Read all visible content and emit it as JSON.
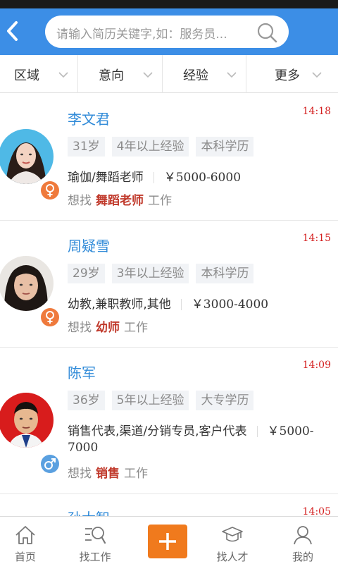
{
  "header": {
    "search_placeholder": "请输入简历关键字,如：服务员..."
  },
  "filters": [
    {
      "label": "区域"
    },
    {
      "label": "意向"
    },
    {
      "label": "经验"
    },
    {
      "label": "更多"
    }
  ],
  "candidates": [
    {
      "name": "李文君",
      "time": "14:18",
      "gender": "female",
      "age": "31岁",
      "experience": "4年以上经验",
      "education": "本科学历",
      "jobs": "瑜伽/舞蹈老师",
      "salary": "￥5000-6000",
      "want_prefix": "想找",
      "want_position": "舞蹈老师",
      "want_suffix": "工作"
    },
    {
      "name": "周疑雪",
      "time": "14:15",
      "gender": "female",
      "age": "29岁",
      "experience": "3年以上经验",
      "education": "本科学历",
      "jobs": "幼教,兼职教师,其他",
      "salary": "￥3000-4000",
      "want_prefix": "想找",
      "want_position": "幼师",
      "want_suffix": "工作"
    },
    {
      "name": "陈军",
      "time": "14:09",
      "gender": "male",
      "age": "36岁",
      "experience": "5年以上经验",
      "education": "大专学历",
      "jobs": "销售代表,渠道/分销专员,客户代表",
      "salary_line1": "￥5000-",
      "salary_line2": "7000",
      "want_prefix": "想找",
      "want_position": "销售",
      "want_suffix": "工作"
    },
    {
      "name": "孙大智",
      "time": "14:05"
    }
  ],
  "tabs": [
    {
      "label": "首页",
      "icon": "home-icon"
    },
    {
      "label": "找工作",
      "icon": "job-search-icon"
    },
    {
      "label": "",
      "icon": "plus-icon"
    },
    {
      "label": "找人才",
      "icon": "graduate-icon"
    },
    {
      "label": "我的",
      "icon": "user-icon"
    }
  ],
  "colors": {
    "header": "#3c8ee6",
    "name": "#2f8ad8",
    "time": "#d42020",
    "plus": "#f07a1d",
    "female": "#ef7a3c",
    "male": "#5aa0e0"
  }
}
